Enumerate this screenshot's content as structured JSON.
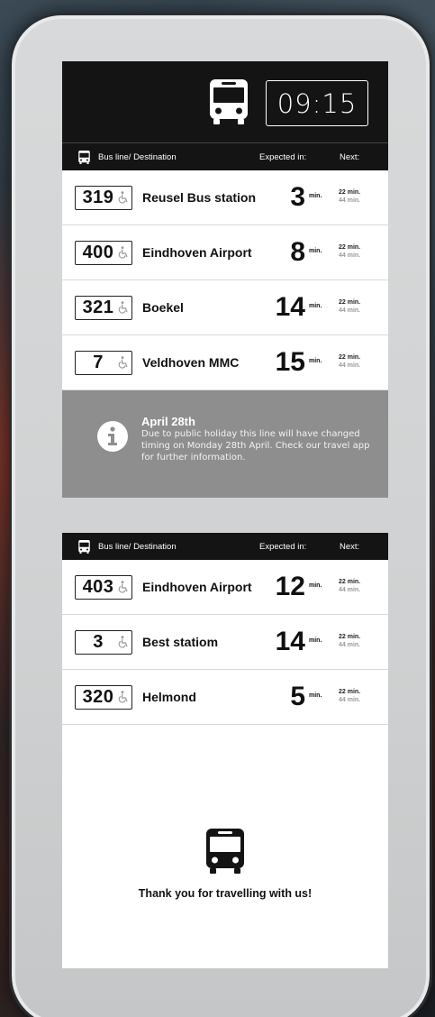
{
  "clock": {
    "time": "09:15"
  },
  "headers": {
    "destination": "Bus line/ Destination",
    "expected": "Expected in:",
    "next": "Next:"
  },
  "top_board": {
    "rows": [
      {
        "line": "319",
        "destination": "Reusel Bus station",
        "minutes": "3",
        "unit": "min.",
        "next1": "22 min.",
        "next2": "44 min."
      },
      {
        "line": "400",
        "destination": "Eindhoven Airport",
        "minutes": "8",
        "unit": "min.",
        "next1": "22 min.",
        "next2": "44 min."
      },
      {
        "line": "321",
        "destination": "Boekel",
        "minutes": "14",
        "unit": "min.",
        "next1": "22 min.",
        "next2": "44 min."
      },
      {
        "line": "7",
        "destination": "Veldhoven MMC",
        "minutes": "15",
        "unit": "min.",
        "next1": "22 min.",
        "next2": "44 min."
      }
    ],
    "notice": {
      "title": "April 28th",
      "text": "Due to public holiday this line will have changed timing on Monday 28th April. Check our travel app for further information."
    }
  },
  "bottom_board": {
    "rows": [
      {
        "line": "403",
        "destination": "Eindhoven Airport",
        "minutes": "12",
        "unit": "min.",
        "next1": "22 min.",
        "next2": "44 min."
      },
      {
        "line": "3",
        "destination": "Best statiom",
        "minutes": "14",
        "unit": "min.",
        "next1": "22 min.",
        "next2": "44 min."
      },
      {
        "line": "320",
        "destination": "Helmond",
        "minutes": "5",
        "unit": "min.",
        "next1": "22 min.",
        "next2": "44 min."
      }
    ],
    "thank_you": "Thank you for travelling with us!"
  },
  "icons": {
    "bus": "bus-icon",
    "info": "info-icon",
    "accessibility": "wheelchair-icon"
  },
  "colors": {
    "header_bg": "#141414",
    "notice_bg": "#8e8e8e",
    "panel": "#d7d9da"
  }
}
